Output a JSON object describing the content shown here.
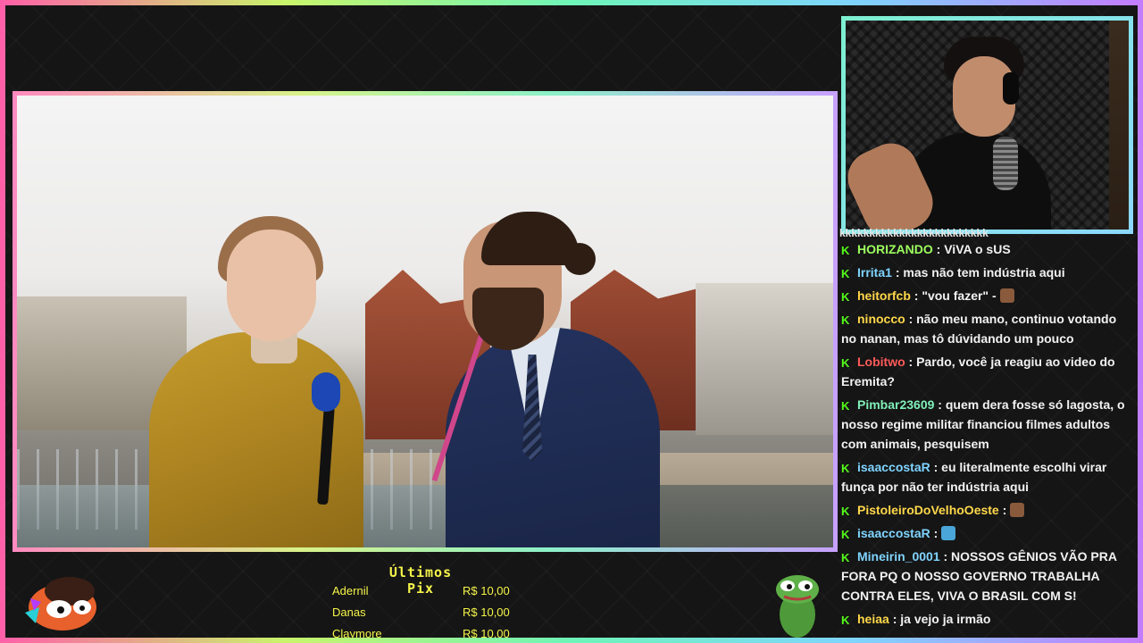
{
  "pix_panel": {
    "title": "Últimos Pix",
    "donations": [
      {
        "name": "Adernil",
        "amount": "R$ 10,00"
      },
      {
        "name": "Danas",
        "amount": "R$ 10,00"
      },
      {
        "name": "Claymore",
        "amount": "R$ 10,00"
      }
    ]
  },
  "chat": {
    "top_overflow": "kkkkkkkkkkkkkkkkkkkkkkkkk",
    "messages": [
      {
        "user": "HORIZANDO",
        "color": "#9dff5e",
        "text": ": ViVA o sUS"
      },
      {
        "user": "Irrita1",
        "color": "#7fd4ff",
        "text": ": mas não tem indústria aqui"
      },
      {
        "user": "heitorfcb",
        "color": "#ffd84a",
        "text": ": \"vou fazer\" -"
      },
      {
        "user": "ninocco",
        "color": "#ffd84a",
        "text": ": não meu mano, continuo votando no nanan, mas tô dúvidando um pouco"
      },
      {
        "user": "Lobitwo",
        "color": "#ff5a5a",
        "text": ": Pardo, você ja reagiu ao video do Eremita?"
      },
      {
        "user": "Pimbar23609",
        "color": "#7ff0b8",
        "text": ": quem dera fosse só lagosta, o nosso regime militar financiou filmes adultos com animais, pesquisem"
      },
      {
        "user": "isaaccostaR",
        "color": "#7fd4ff",
        "text": ": eu literalmente escolhi virar funça por não ter indústria aqui"
      },
      {
        "user": "PistoleiroDoVelhoOeste",
        "color": "#ffd84a",
        "text": ":"
      },
      {
        "user": "isaaccostaR",
        "color": "#7fd4ff",
        "text": ":"
      },
      {
        "user": "Mineirin_0001",
        "color": "#7fd4ff",
        "text": ": NOSSOS GÊNIOS VÃO PRA FORA PQ O NOSSO GOVERNO TRABALHA CONTRA ELES, VIVA O BRASIL COM S!"
      },
      {
        "user": "heiaa",
        "color": "#ffd84a",
        "text": ": ja vejo ja irmão"
      }
    ]
  },
  "colors": {
    "accent_badge": "#53fc18",
    "pix_text": "#f6f54a"
  },
  "icons": {
    "chat_badge": "kick-badge-icon",
    "mascot": "cartoon-mascot-icon",
    "frog": "pepe-frog-icon"
  }
}
